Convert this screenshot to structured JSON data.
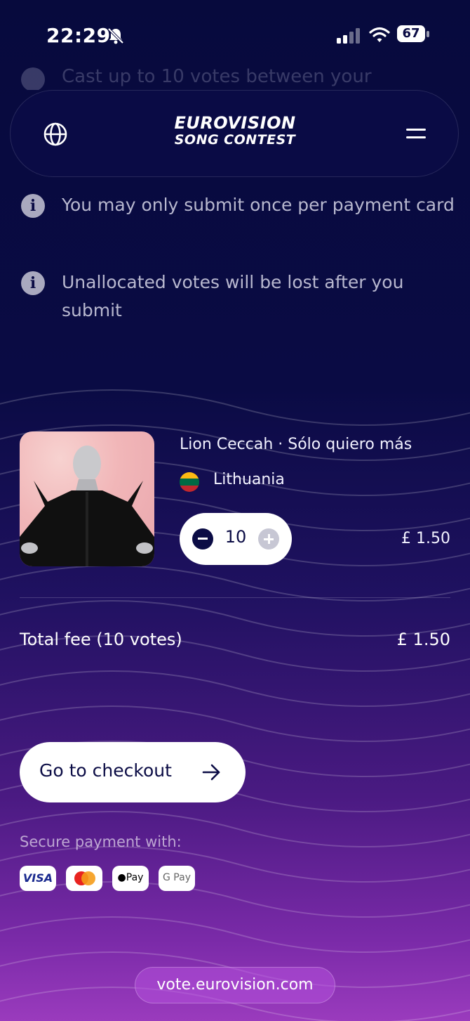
{
  "status_bar": {
    "time": "22:29",
    "battery": "67"
  },
  "ghost_text": "Cast up to 10 votes between your",
  "nav": {
    "logo_line1": "EUROVISION",
    "logo_line2": "SONG CONTEST"
  },
  "info_items": [
    {
      "icon": "info-icon",
      "text": "You may only submit once per payment card"
    },
    {
      "icon": "info-icon",
      "text": "Unallocated votes will be lost after you submit"
    }
  ],
  "entry": {
    "title": "Lion Ceccah · Sólo quiero más",
    "country": "Lithuania",
    "flag_colors": [
      "#fdb913",
      "#006a44",
      "#c1272d"
    ],
    "votes": "10",
    "price": "£ 1.50"
  },
  "total": {
    "label": "Total fee (10 votes)",
    "value": "£ 1.50"
  },
  "checkout": {
    "label": "Go to checkout"
  },
  "payment": {
    "label": "Secure payment with:",
    "visa": "VISA",
    "apple": "Pay",
    "gpay": "G Pay"
  },
  "url": "vote.eurovision.com"
}
